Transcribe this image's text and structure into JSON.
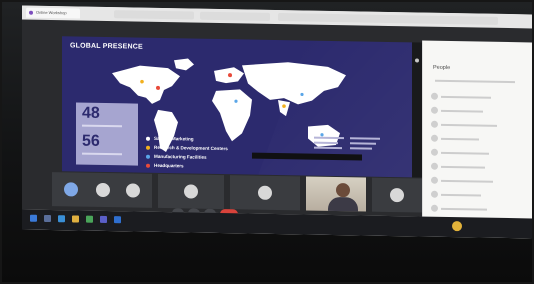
{
  "browser": {
    "tabs": [
      {
        "label": "Online Workshop"
      },
      {
        "label": ""
      },
      {
        "label": ""
      },
      {
        "label": ""
      }
    ]
  },
  "slide": {
    "title": "GLOBAL PRESENCE",
    "stats": [
      {
        "value": "48"
      },
      {
        "value": "56"
      }
    ],
    "legend": [
      {
        "label": "Sales & Marketing",
        "color": "#ffffff"
      },
      {
        "label": "Research & Development Centers",
        "color": "#f2b01e"
      },
      {
        "label": "Manufacturing Facilities",
        "color": "#5aa6e8"
      },
      {
        "label": "Headquarters",
        "color": "#e84a3a"
      }
    ],
    "caption": ""
  },
  "people_panel": {
    "title": "People"
  },
  "taskbar": {
    "tray_text": ""
  },
  "colors": {
    "slide_bg": "#2c2a6e",
    "map_land": "#ffffff",
    "stats_box": "#a6a5d0",
    "end_call": "#d9433b"
  }
}
